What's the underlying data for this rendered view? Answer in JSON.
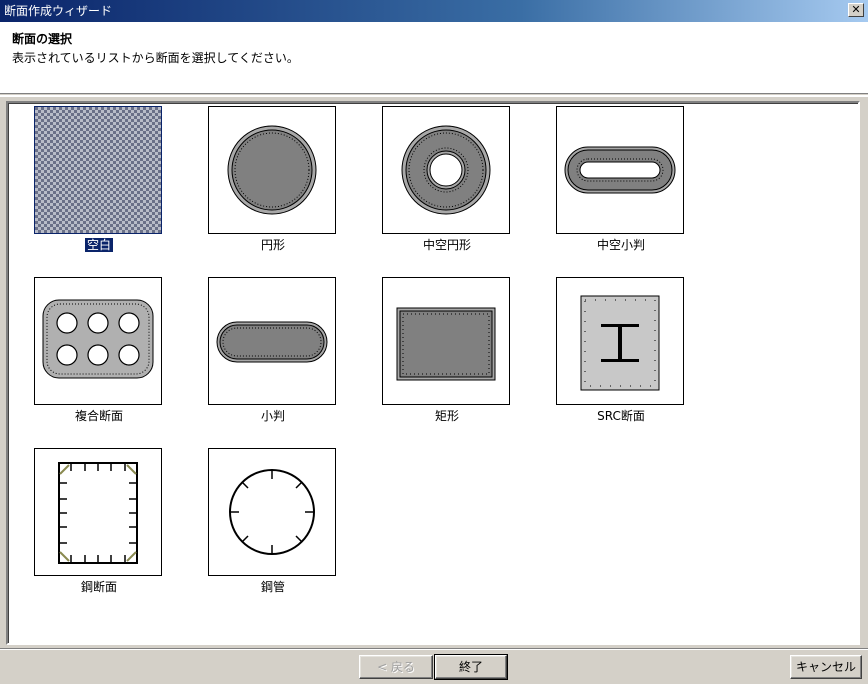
{
  "window": {
    "title": "断面作成ウィザード",
    "close_glyph": "✕"
  },
  "header": {
    "title": "断面の選択",
    "subtitle": "表示されているリストから断面を選択してください。"
  },
  "sections": [
    {
      "label": "空白",
      "icon": "blank-pattern-icon",
      "selected": true
    },
    {
      "label": "円形",
      "icon": "circle-section-icon"
    },
    {
      "label": "中空円形",
      "icon": "hollow-circle-section-icon"
    },
    {
      "label": "中空小判",
      "icon": "hollow-oval-section-icon"
    },
    {
      "label": "複合断面",
      "icon": "composite-section-icon"
    },
    {
      "label": "小判",
      "icon": "oval-section-icon"
    },
    {
      "label": "矩形",
      "icon": "rectangle-section-icon"
    },
    {
      "label": "SRC断面",
      "icon": "src-section-icon"
    },
    {
      "label": "鋼断面",
      "icon": "steel-section-icon"
    },
    {
      "label": "鋼管",
      "icon": "steel-pipe-icon"
    }
  ],
  "buttons": {
    "back": "< 戻る",
    "finish": "終了",
    "cancel": "キャンセル"
  }
}
